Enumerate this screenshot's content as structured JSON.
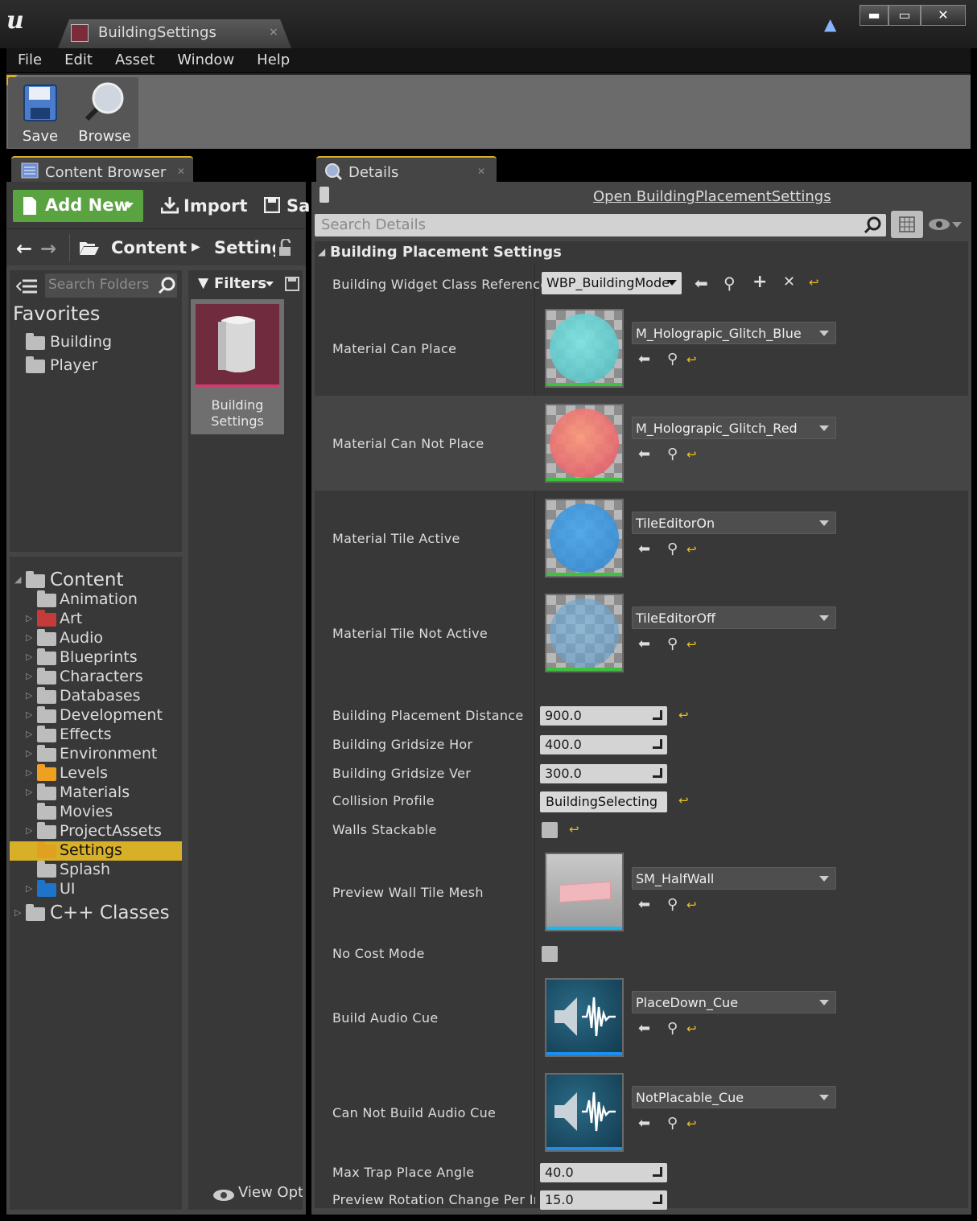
{
  "window": {
    "doc_tab": "BuildingSettings",
    "close_glyph": "×",
    "controls": {
      "minimize": "▬",
      "maximize": "▭",
      "close": "✕"
    }
  },
  "menu": [
    "File",
    "Edit",
    "Asset",
    "Window",
    "Help"
  ],
  "toolbar": {
    "save": "Save",
    "browse": "Browse"
  },
  "content_browser": {
    "tab": "Content Browser",
    "add_new": "Add New",
    "import": "Import",
    "save_all": "Sa",
    "path": [
      "Content",
      "Setting"
    ],
    "search_folders": "Search Folders",
    "filters": "Filters",
    "favorites_title": "Favorites",
    "favorites": [
      "Building",
      "Player"
    ],
    "tree_root": "Content",
    "tree": [
      {
        "label": "Animation",
        "expand": false,
        "color": "#bdbdbd"
      },
      {
        "label": "Art",
        "expand": true,
        "color": "#c33b3b"
      },
      {
        "label": "Audio",
        "expand": true,
        "color": "#bdbdbd"
      },
      {
        "label": "Blueprints",
        "expand": true,
        "color": "#bdbdbd"
      },
      {
        "label": "Characters",
        "expand": true,
        "color": "#bdbdbd"
      },
      {
        "label": "Databases",
        "expand": true,
        "color": "#bdbdbd"
      },
      {
        "label": "Development",
        "expand": true,
        "color": "#bdbdbd"
      },
      {
        "label": "Effects",
        "expand": true,
        "color": "#bdbdbd"
      },
      {
        "label": "Environment",
        "expand": true,
        "color": "#bdbdbd"
      },
      {
        "label": "Levels",
        "expand": true,
        "color": "#f0a020"
      },
      {
        "label": "Materials",
        "expand": true,
        "color": "#bdbdbd"
      },
      {
        "label": "Movies",
        "expand": false,
        "color": "#bdbdbd"
      },
      {
        "label": "ProjectAssets",
        "expand": true,
        "color": "#bdbdbd"
      },
      {
        "label": "Settings",
        "expand": false,
        "color": "#e0a020",
        "selected": true
      },
      {
        "label": "Splash",
        "expand": false,
        "color": "#bdbdbd"
      },
      {
        "label": "UI",
        "expand": true,
        "color": "#1e74c8"
      }
    ],
    "cpp_classes": "C++ Classes",
    "asset_name_1": "Building",
    "asset_name_2": "Settings",
    "view_options": "View Opti"
  },
  "details": {
    "tab": "Details",
    "open_link": "Open BuildingPlacementSettings",
    "search_placeholder": "Search Details",
    "category": "Building Placement Settings",
    "widget_class": {
      "label": "Building Widget Class Reference",
      "value": "WBP_BuildingMode"
    },
    "materials": [
      {
        "label": "Material Can Place",
        "value": "M_Holograpic_Glitch_Blue"
      },
      {
        "label": "Material Can Not Place",
        "value": "M_Holograpic_Glitch_Red"
      },
      {
        "label": "Material Tile Active",
        "value": "TileEditorOn"
      },
      {
        "label": "Material Tile Not Active",
        "value": "TileEditorOff"
      }
    ],
    "numbers": [
      {
        "label": "Building Placement Distance",
        "value": "900.0"
      },
      {
        "label": "Building Gridsize Hor",
        "value": "400.0"
      },
      {
        "label": "Building Gridsize Ver",
        "value": "300.0"
      }
    ],
    "collision": {
      "label": "Collision Profile",
      "value": "BuildingSelecting"
    },
    "walls_stackable": {
      "label": "Walls Stackable",
      "checked": false
    },
    "preview_mesh": {
      "label": "Preview Wall Tile Mesh",
      "value": "SM_HalfWall"
    },
    "no_cost": {
      "label": "No Cost Mode",
      "checked": false
    },
    "audio": [
      {
        "label": "Build Audio Cue",
        "value": "PlaceDown_Cue"
      },
      {
        "label": "Can Not Build Audio Cue",
        "value": "NotPlacable_Cue"
      }
    ],
    "max_trap": {
      "label": "Max Trap Place Angle",
      "value": "40.0"
    },
    "preview_rot": {
      "label": "Preview Rotation Change Per Inp",
      "value": "15.0"
    }
  },
  "colors": {
    "accent_yellow": "#d8b028",
    "add_new_green": "#5aa341",
    "reset_arrow": "#e8c020"
  }
}
